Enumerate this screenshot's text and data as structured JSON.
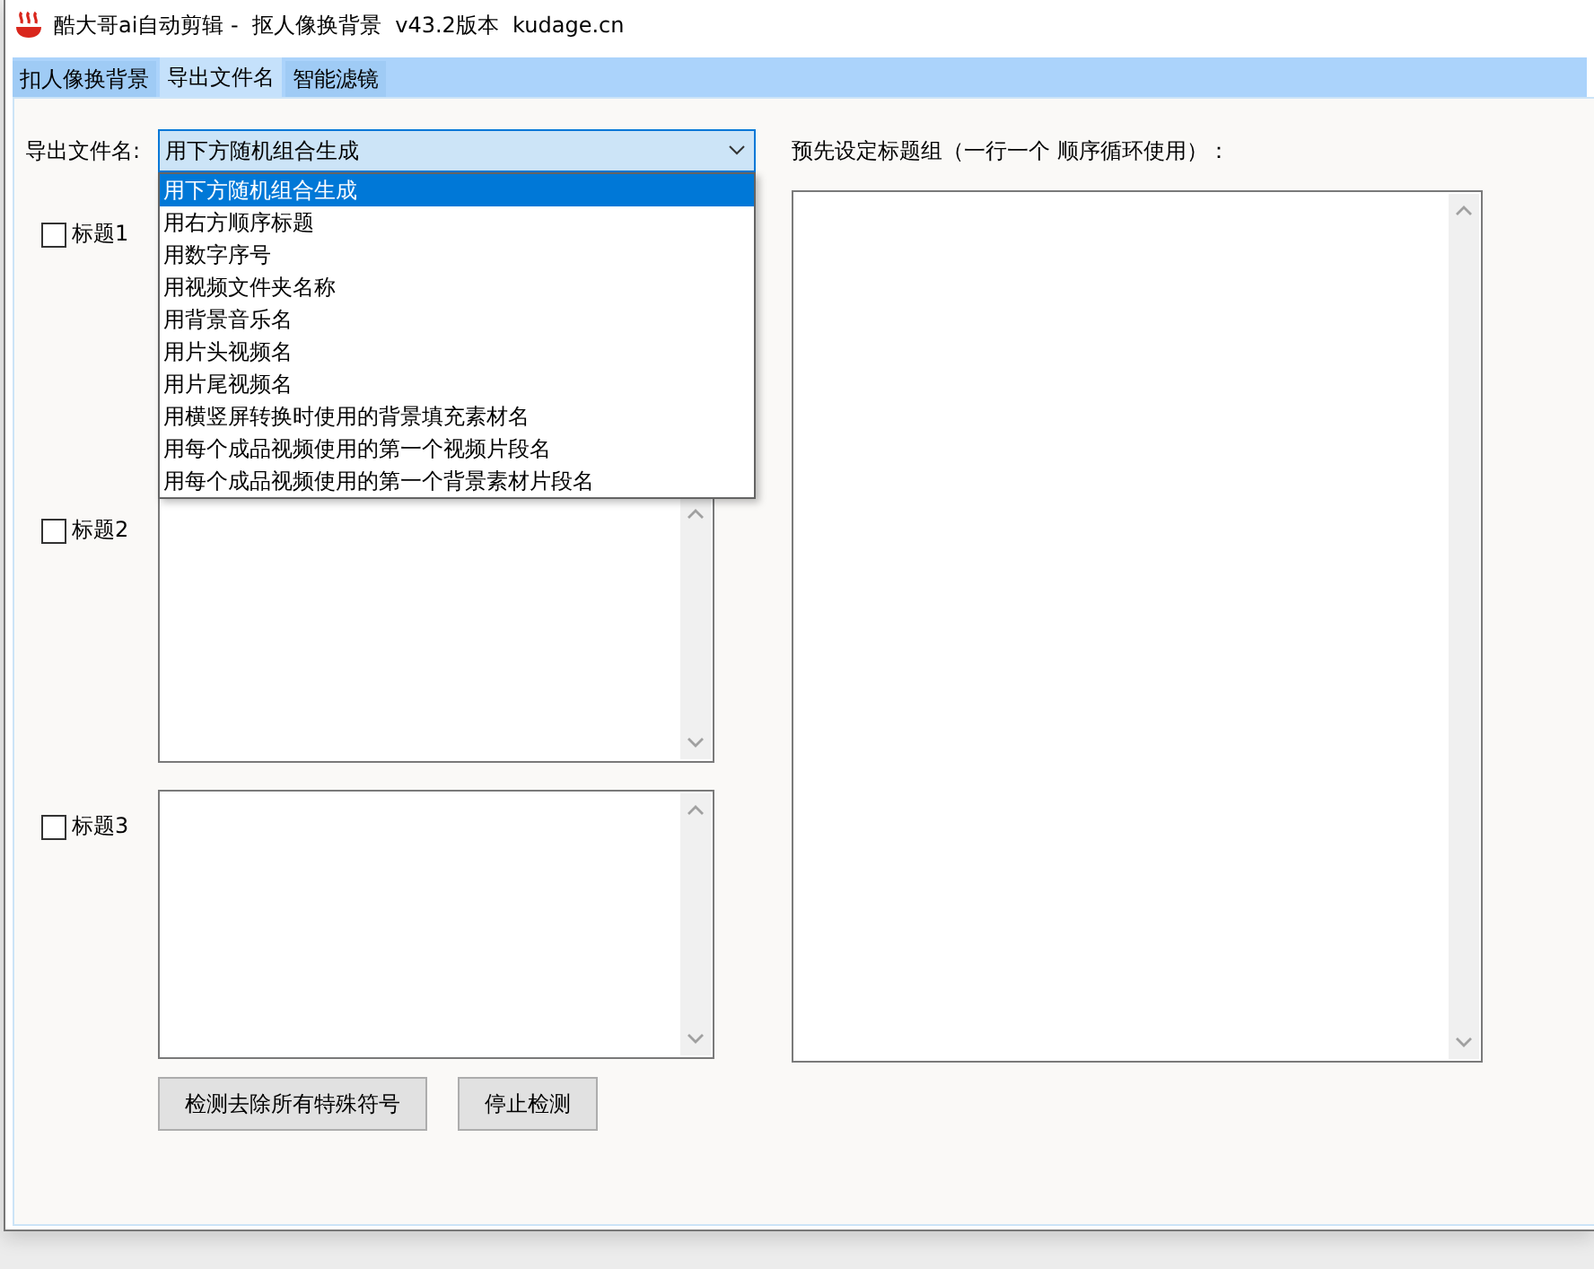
{
  "window": {
    "title": "酷大哥ai自动剪辑 -  抠人像换背景  v43.2版本  kudage.cn"
  },
  "tabs": [
    {
      "label": "扣人像换背景",
      "selected": false
    },
    {
      "label": "导出文件名",
      "selected": true
    },
    {
      "label": "智能滤镜",
      "selected": false
    }
  ],
  "export_name": {
    "label": "导出文件名:",
    "value": "用下方随机组合生成",
    "expanded": true,
    "options": [
      {
        "label": "用下方随机组合生成",
        "selected": true
      },
      {
        "label": "用右方顺序标题",
        "selected": false
      },
      {
        "label": "用数字序号",
        "selected": false
      },
      {
        "label": "用视频文件夹名称",
        "selected": false
      },
      {
        "label": "用背景音乐名",
        "selected": false
      },
      {
        "label": "用片头视频名",
        "selected": false
      },
      {
        "label": "用片尾视频名",
        "selected": false
      },
      {
        "label": "用横竖屏转换时使用的背景填充素材名",
        "selected": false
      },
      {
        "label": "用每个成品视频使用的第一个视频片段名",
        "selected": false
      },
      {
        "label": "用每个成品视频使用的第一个背景素材片段名",
        "selected": false
      }
    ]
  },
  "titles": [
    {
      "label": "标题1",
      "checked": false
    },
    {
      "label": "标题2",
      "checked": false
    },
    {
      "label": "标题3",
      "checked": false
    }
  ],
  "preset": {
    "label": "预先设定标题组（一行一个 顺序循环使用）："
  },
  "buttons": [
    "检测去除所有特殊符号",
    "停止检测"
  ]
}
